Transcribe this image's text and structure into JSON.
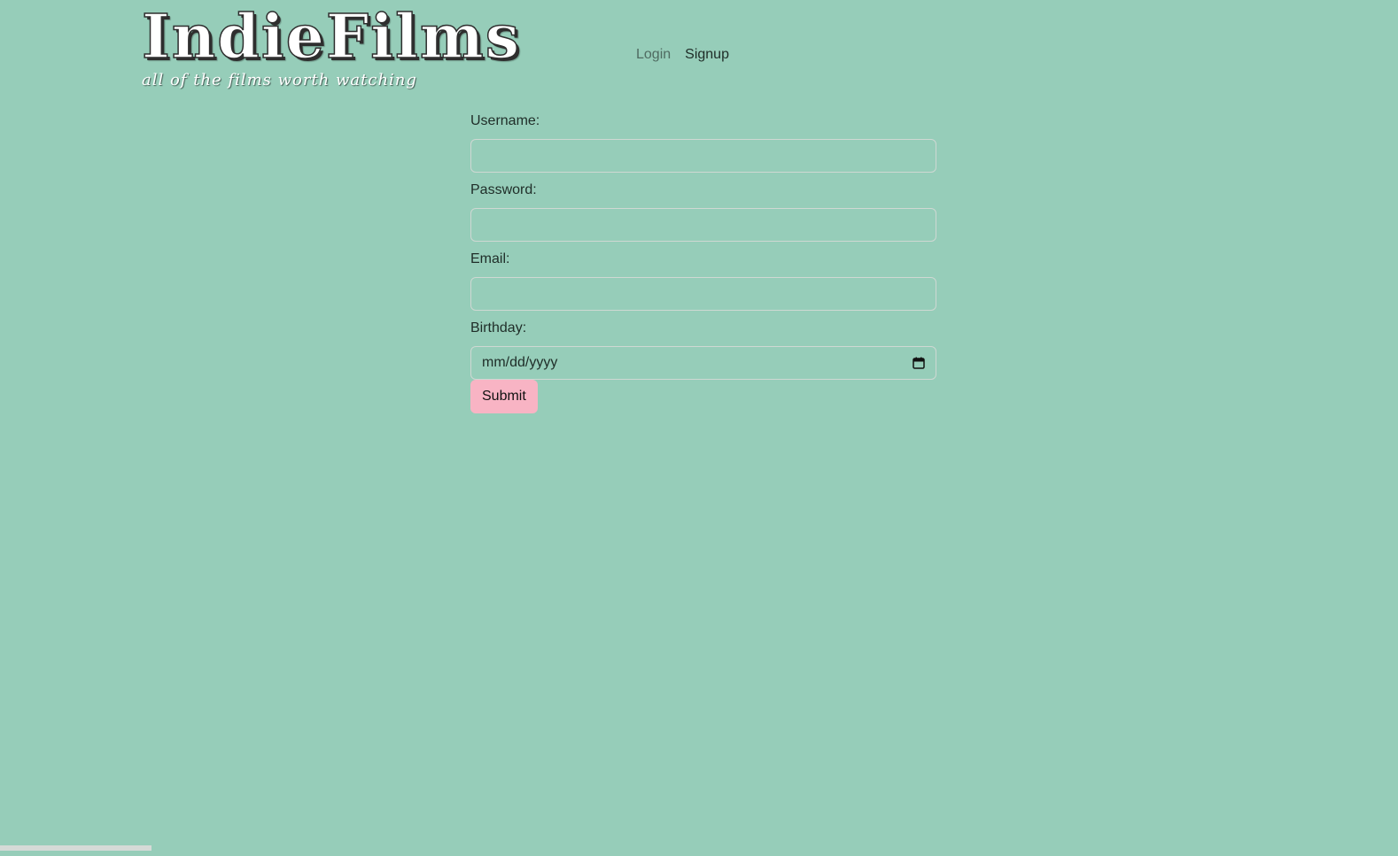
{
  "brand": {
    "title": "IndieFilms",
    "tagline": "all of the films worth watching"
  },
  "nav": {
    "login_label": "Login",
    "signup_label": "Signup"
  },
  "form": {
    "username_label": "Username:",
    "username_value": "",
    "password_label": "Password:",
    "password_value": "",
    "email_label": "Email:",
    "email_value": "",
    "birthday_label": "Birthday:",
    "birthday_placeholder": "mm/dd/yyyy",
    "submit_label": "Submit"
  },
  "colors": {
    "background": "#96cdb9",
    "submit_button": "#f8b4c4"
  },
  "icons": {
    "birthday_picker": "calendar-icon"
  }
}
